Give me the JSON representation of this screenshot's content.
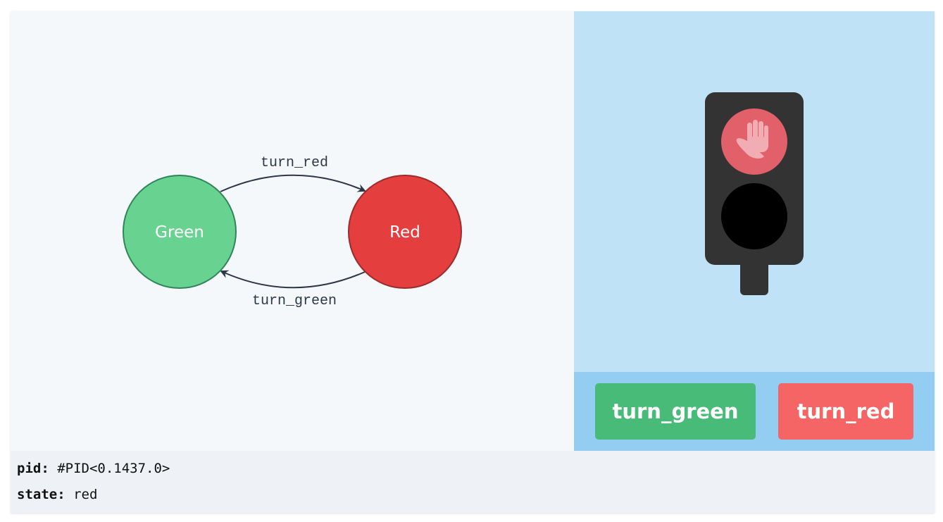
{
  "diagram": {
    "states": [
      {
        "label": "Green",
        "color": "#68d391"
      },
      {
        "label": "Red",
        "color": "#e53e3e"
      }
    ],
    "transitions": [
      {
        "label": "turn_red",
        "from": "Green",
        "to": "Red"
      },
      {
        "label": "turn_green",
        "from": "Red",
        "to": "Green"
      }
    ]
  },
  "traffic_light": {
    "active_signal": "red",
    "stop_icon": "raised-hand-icon",
    "colors": {
      "housing": "#333333",
      "red_lamp": "#e2606a",
      "off_lamp": "#000000"
    }
  },
  "buttons": {
    "turn_green": {
      "label": "turn_green",
      "color": "#48bb78"
    },
    "turn_red": {
      "label": "turn_red",
      "color": "#f56565"
    }
  },
  "info": {
    "pid_label": "pid:",
    "pid_value": "#PID<0.1437.0>",
    "state_label": "state:",
    "state_value": "red"
  }
}
